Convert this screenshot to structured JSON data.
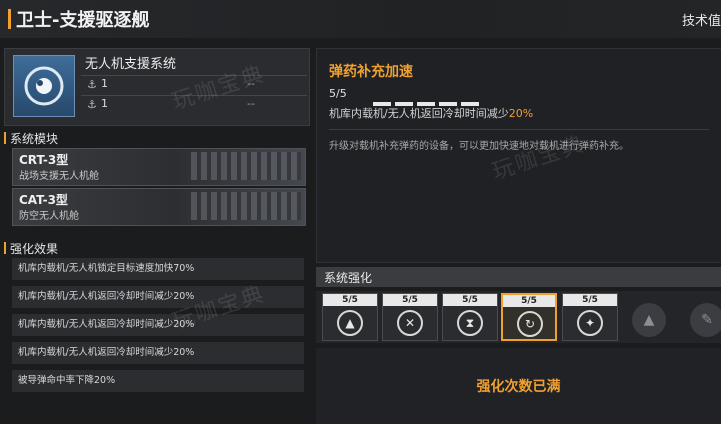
{
  "header": {
    "title": "卫士-支援驱逐舰",
    "tech_link": "技术值"
  },
  "system": {
    "name": "无人机支援系统",
    "stats": [
      {
        "icon": "stat-icon",
        "value": "1",
        "extra": "--"
      },
      {
        "icon": "stat-icon",
        "value": "1",
        "extra": "--"
      }
    ]
  },
  "modules": {
    "heading": "系统模块",
    "items": [
      {
        "name": "CRT-3型",
        "desc": "战场支援无人机舱"
      },
      {
        "name": "CAT-3型",
        "desc": "防空无人机舱"
      }
    ]
  },
  "effects": {
    "heading": "强化效果",
    "items": [
      "机库内载机/无人机锁定目标速度加快70%",
      "机库内载机/无人机返回冷却时间减少20%",
      "机库内载机/无人机返回冷却时间减少20%",
      "机库内载机/无人机返回冷却时间减少20%",
      "被导弹命中率下降20%"
    ]
  },
  "upgrade": {
    "title": "弹药补充加速",
    "level": "5/5",
    "effect_prefix": "机库内载机/无人机返回冷却时间减少",
    "effect_value": "20%",
    "description": "升级对载机补充弹药的设备，可以更加快速地对载机进行弹药补充。"
  },
  "enhance": {
    "heading": "系统强化",
    "slots": [
      {
        "level": "5/5",
        "icon": "speed-icon"
      },
      {
        "level": "5/5",
        "icon": "cooldown-x-icon"
      },
      {
        "level": "5/5",
        "icon": "hourglass-icon"
      },
      {
        "level": "5/5",
        "icon": "ammo-reload-icon"
      },
      {
        "level": "5/5",
        "icon": "signal-icon"
      }
    ],
    "locked": [
      "locked-speed-icon",
      "locked-wrench-icon"
    ],
    "maxed_text": "强化次数已满"
  },
  "watermark": "玩咖宝典"
}
